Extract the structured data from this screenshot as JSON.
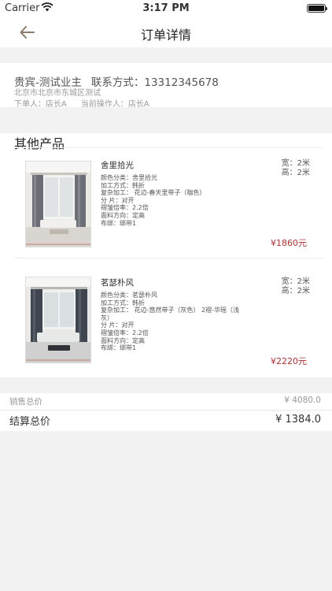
{
  "status_bar": {
    "carrier": "Carrier",
    "time": "3:17 PM"
  },
  "nav": {
    "title": "订单详情"
  },
  "customer": {
    "name": "贵宾-测试业主",
    "contact": "联系方式：13312345678",
    "address": "北京市北京市东城区测试",
    "creator": "下单人：店长A",
    "operator": "当前操作人：店长A"
  },
  "section": {
    "title": "其他产品"
  },
  "products": [
    {
      "name": "舍里拾光",
      "color_class": "颜色分类：舍里拾光",
      "process": "加工方式：韩折",
      "complex": "复杂加工：   花边-春天里带子（咖色）",
      "split": "分 片：对开",
      "fold": "褶皱倍率：2.2倍",
      "direction": "面料方向：定高",
      "strap": "布绑：绑带1",
      "width": "宽：2米",
      "height": "高：2米",
      "price": "¥1860元"
    },
    {
      "name": "茗瑟朴风",
      "color_class": "颜色分类：茗瑟朴风",
      "process": "加工方式：韩折",
      "complex": "复杂加工：   花边-悠然带子（灰色）  2褶-华瑶（浅灰）",
      "split": "分 片：对开",
      "fold": "褶皱倍率：2.2倍",
      "direction": "面料方向：定高",
      "strap": "布绑：绑带1",
      "width": "宽：2米",
      "height": "高：2米",
      "price": "¥2220元"
    }
  ],
  "totals": {
    "sale_label": "销售总价",
    "sale_value": "¥ 4080.0",
    "settle_label": "结算总价",
    "settle_value": "¥ 1384.0"
  },
  "colors": {
    "price": "#aa3333",
    "background": "#f2f2f2",
    "accent": "#8b7355"
  }
}
